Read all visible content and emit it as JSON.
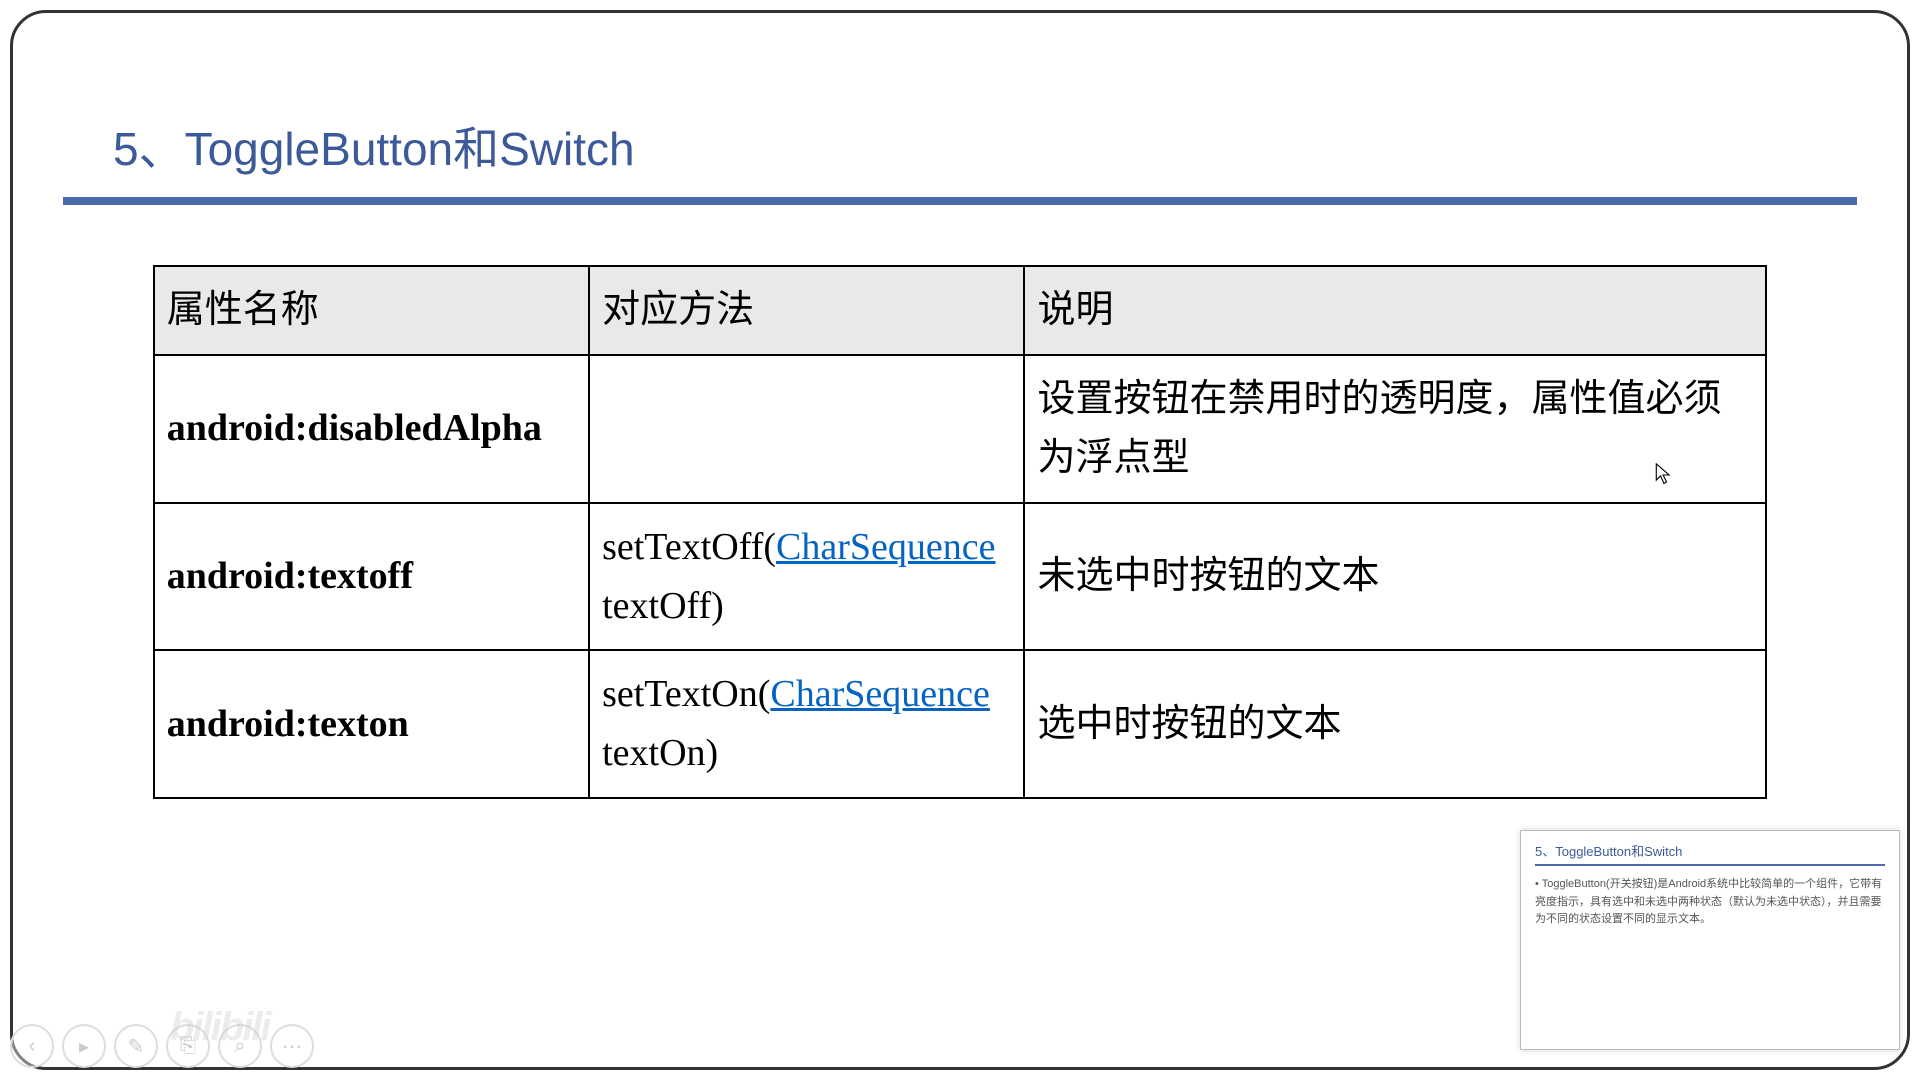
{
  "slide": {
    "title": "5、ToggleButton和Switch",
    "table": {
      "headers": [
        "属性名称",
        "对应方法",
        "说明"
      ],
      "rows": [
        {
          "attr": "android:disabledAlpha",
          "method_prefix": "",
          "method_link": "",
          "method_suffix": "",
          "desc": "设置按钮在禁用时的透明度，属性值必须为浮点型"
        },
        {
          "attr": "android:textoff",
          "method_prefix": "setTextOff(",
          "method_link": "CharSequence",
          "method_suffix": " textOff)",
          "desc": "未选中时按钮的文本"
        },
        {
          "attr": "android:texton",
          "method_prefix": "setTextOn(",
          "method_link": "CharSequence",
          "method_suffix": " textOn)",
          "desc": "选中时按钮的文本"
        }
      ]
    }
  },
  "thumbnail": {
    "title": "5、ToggleButton和Switch",
    "body": "ToggleButton(开关按钮)是Android系统中比较简单的一个组件，它带有亮度指示，具有选中和未选中两种状态（默认为未选中状态），并且需要为不同的状态设置不同的显示文本。"
  },
  "controls": {
    "back": "‹",
    "play": "▸",
    "pen": "✎",
    "copy": "⎘",
    "zoom": "⌕",
    "more": "⋯"
  },
  "watermark": "bilibili"
}
